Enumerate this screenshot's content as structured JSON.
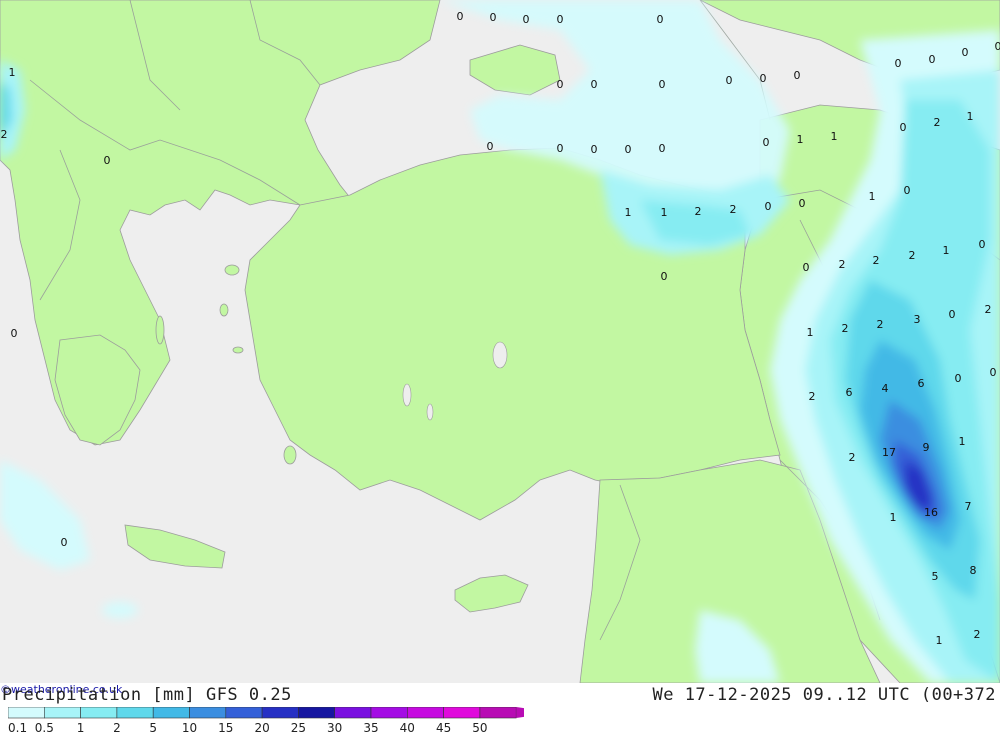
{
  "title": "Precipitation [mm] GFS 0.25",
  "valid_time": "We 17-12-2025 09..12 UTC (00+372",
  "credit": "©weatheronline.co.uk",
  "colors": {
    "sea": "#eeeeee",
    "land": "#c2f7a2",
    "border": "#9aa19a",
    "coast": "#9c9c9c"
  },
  "legend": {
    "labels": [
      "0.1",
      "0.5",
      "1",
      "2",
      "5",
      "10",
      "15",
      "20",
      "25",
      "30",
      "35",
      "40",
      "45",
      "50"
    ],
    "colors": [
      "#d4fbfd",
      "#a8f4f8",
      "#86ecf2",
      "#5fd8eb",
      "#42b9e6",
      "#3b8ee0",
      "#3460d8",
      "#2630c4",
      "#1616a0",
      "#7a10e0",
      "#a40ce4",
      "#c60ae0",
      "#e00adc",
      "#b80cb4"
    ]
  },
  "precip_labels": [
    "0",
    "0",
    "0",
    "0",
    "0",
    "1",
    "2",
    "0",
    "0",
    "0",
    "0",
    "0",
    "0",
    "0",
    "0",
    "0",
    "0",
    "0",
    "0",
    "1",
    "1",
    "0",
    "0",
    "0",
    "0",
    "0",
    "1",
    "1",
    "2",
    "2",
    "0",
    "0",
    "0",
    "0",
    "0",
    "2",
    "1",
    "0",
    "1",
    "2",
    "2",
    "1",
    "0",
    "2",
    "2",
    "3",
    "2",
    "0",
    "1",
    "2",
    "6",
    "4",
    "6",
    "0",
    "0",
    "2",
    "17",
    "9",
    "1",
    "2",
    "1",
    "16",
    "7",
    "5",
    "8",
    "1",
    "2",
    "0",
    "0"
  ]
}
